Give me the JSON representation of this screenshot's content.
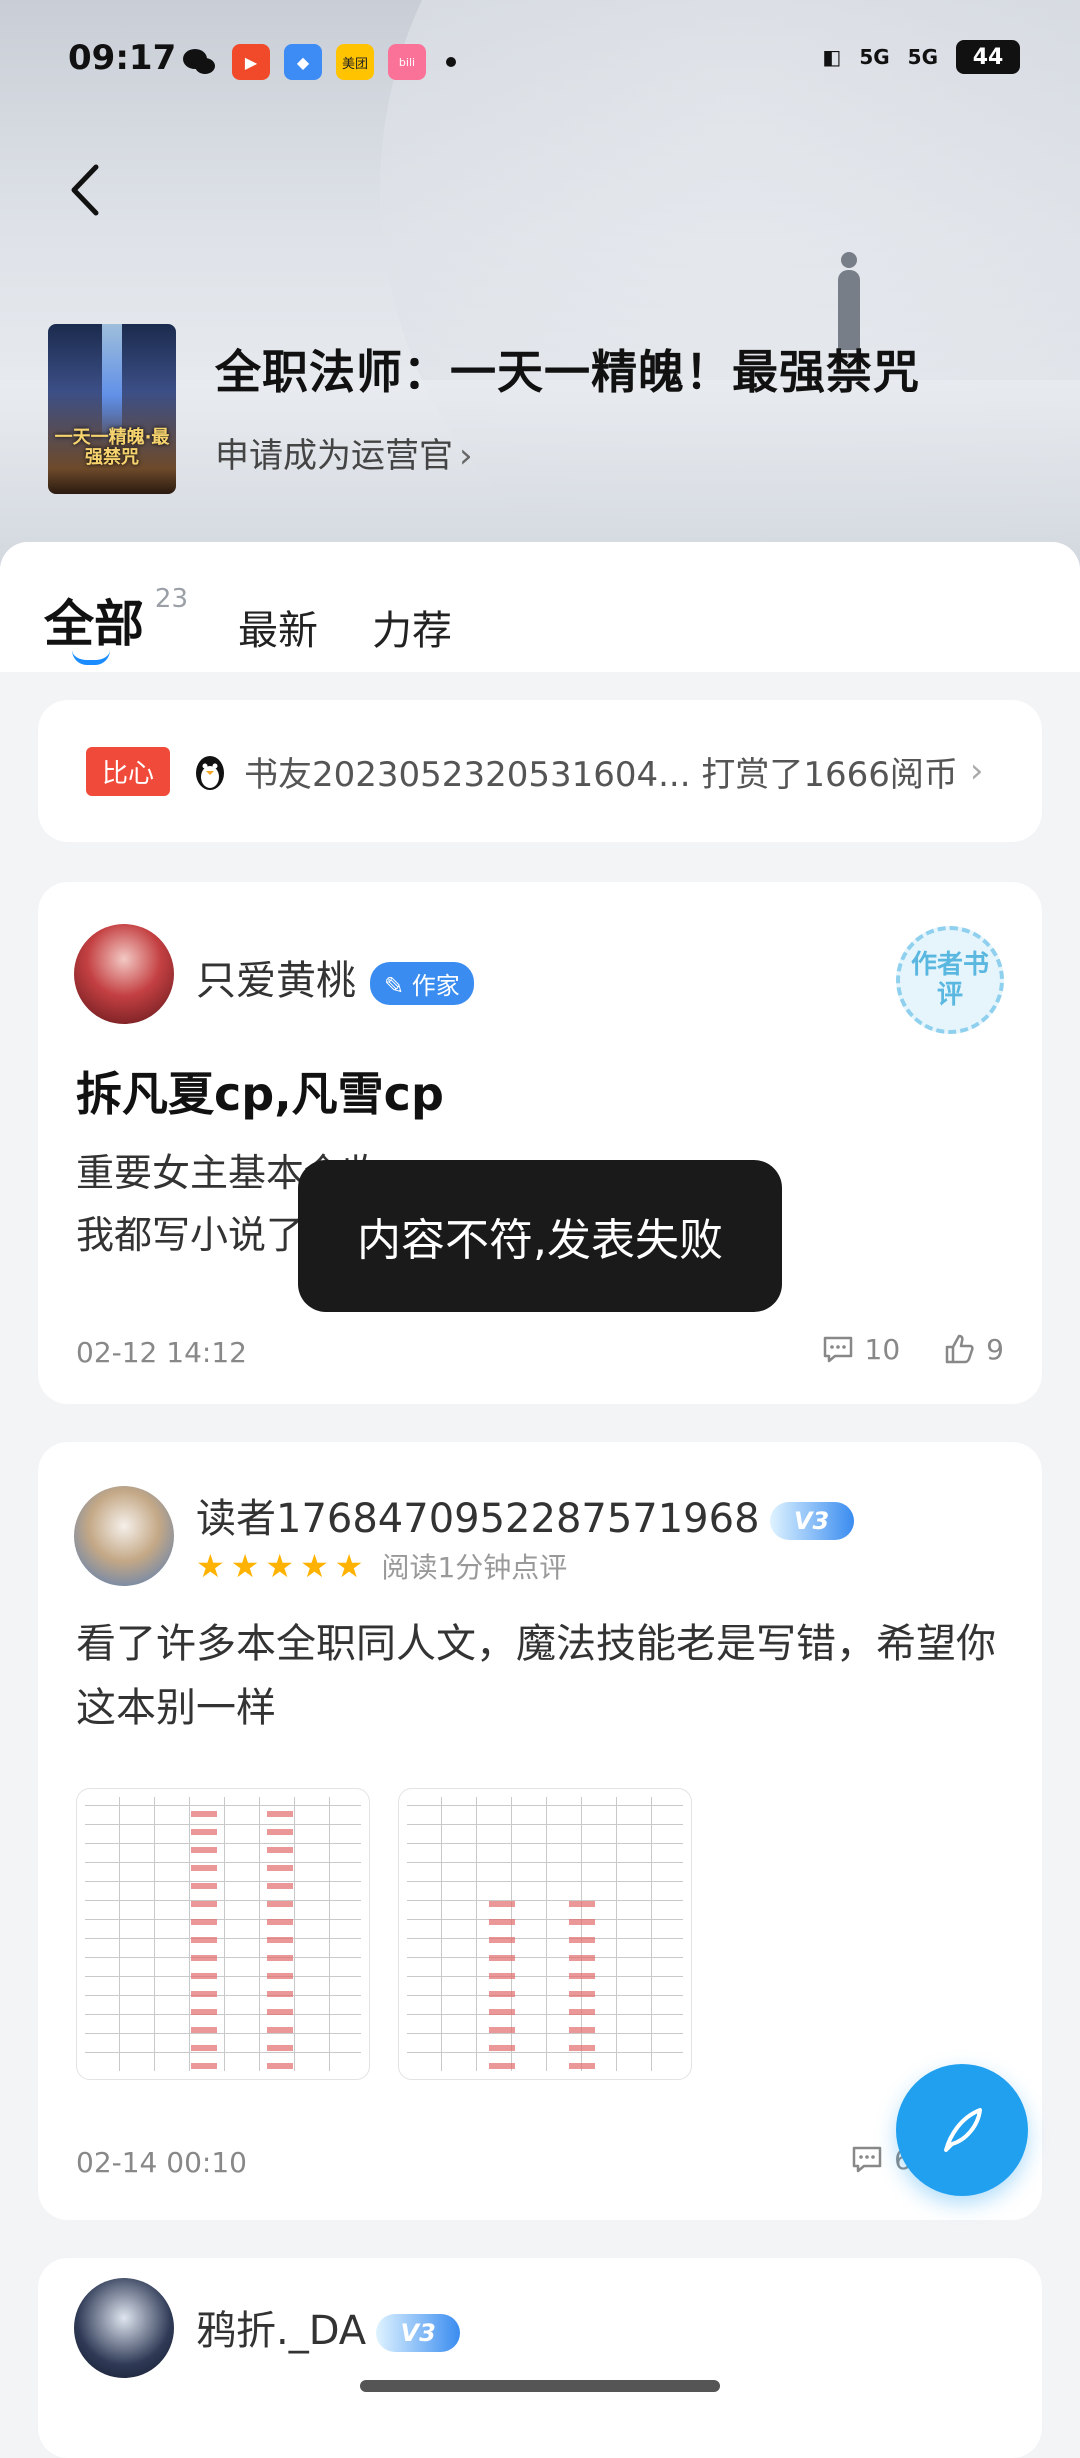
{
  "status_bar": {
    "time": "09:17",
    "apps": [
      "wechat",
      "video",
      "browser",
      "美团",
      "bilibili"
    ],
    "network": [
      "5G",
      "5G"
    ],
    "battery": "44"
  },
  "header": {
    "book_title": "全职法师：一天一精魄！最强禁咒",
    "operator_link": "申请成为运营官",
    "cover_text": "一天一精魄·最强禁咒"
  },
  "tabs": [
    {
      "label": "全部",
      "count": "23",
      "active": true
    },
    {
      "label": "最新"
    },
    {
      "label": "力荐"
    }
  ],
  "tip_banner": {
    "badge": "比心",
    "text": "书友2023052320531604... 打赏了1666阅币",
    "chevron": "›"
  },
  "review1": {
    "username": "只爱黄桃",
    "role_badge": "作家",
    "stamp": "作者书评",
    "title": "拆凡夏cp,凡雪cp",
    "body_lines": [
      "重要女主基本全收。",
      "我都写小说了，"
    ],
    "time": "02-12 14:12",
    "comments": "10",
    "likes": "9"
  },
  "review2": {
    "username": "读者1768470952287571968",
    "vip": "V3",
    "rating_note": "阅读1分钟点评",
    "body": "看了许多本全职同人文，魔法技能老是写错，希望你这本别一样",
    "time": "02-14 00:10",
    "comments": "6"
  },
  "review3": {
    "username": "鸦折._DA",
    "vip": "V3"
  },
  "toast": "内容不符,发表失败",
  "colors": {
    "accent": "#1a8cff",
    "fab": "#21a0f0",
    "badge_red": "#f04a3a",
    "star": "#ffb300"
  }
}
